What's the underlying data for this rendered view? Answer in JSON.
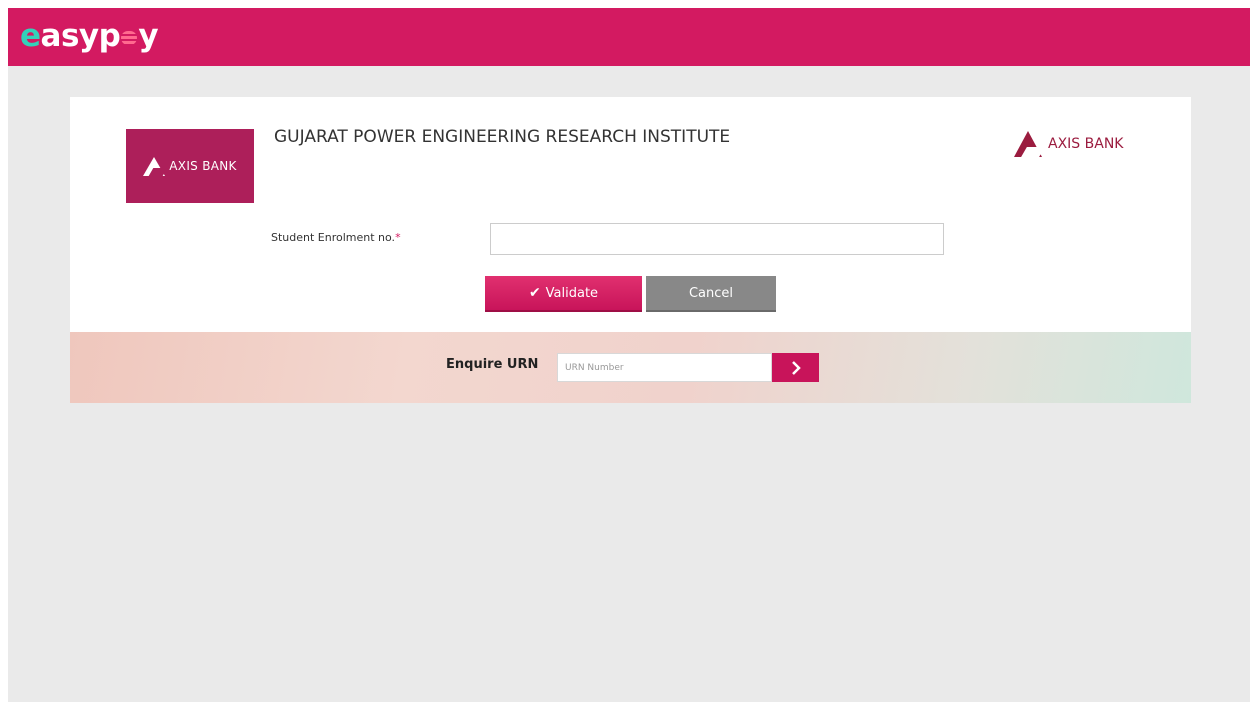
{
  "header": {
    "brand_prefix": "e",
    "brand_mid": "asyp",
    "brand_suffix": "y"
  },
  "card": {
    "logo_text": "AXIS BANK",
    "institute_title": "GUJARAT POWER ENGINEERING RESEARCH INSTITUTE",
    "bank_name": "AXIS BANK",
    "enrolment_label": "Student Enrolment no.",
    "required_mark": "*",
    "enrolment_value": "",
    "validate_label": "Validate",
    "cancel_label": "Cancel"
  },
  "urn": {
    "label": "Enquire URN",
    "placeholder": "URN Number",
    "go_icon": "chevron-right-icon"
  },
  "colors": {
    "brand": "#d31a61",
    "accent": "#33d1b9",
    "cancel": "#888888"
  }
}
